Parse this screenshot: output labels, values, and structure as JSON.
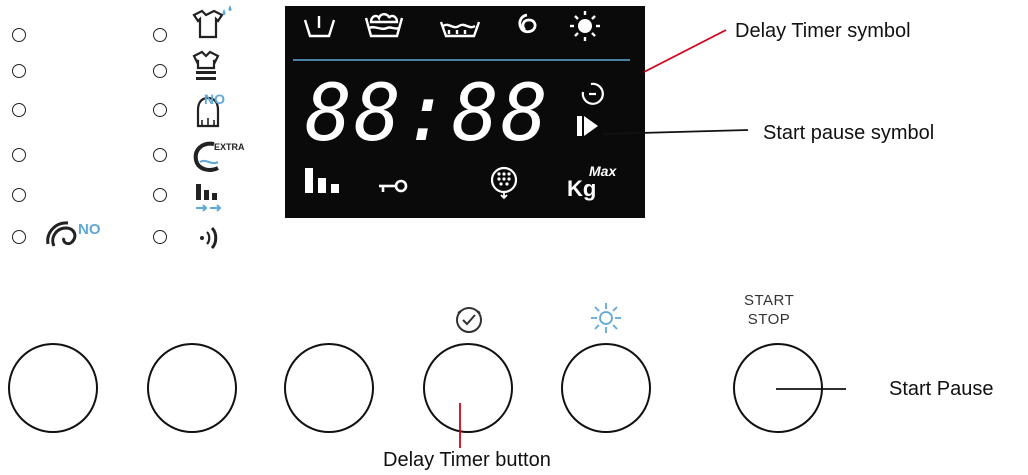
{
  "display": {
    "digits": "88:88",
    "top_icons": [
      "prewash-tub-icon",
      "bubbles-tub-icon",
      "wash-tub-icon",
      "spin-swirl-icon",
      "light-sun-icon"
    ],
    "bottom_icons": [
      "level-bars-icon",
      "key-lock-icon",
      "drain-icon",
      "kg-max-icon"
    ],
    "kg_label": "Kg",
    "max_label": "Max"
  },
  "indicators": {
    "left_column_icons": [
      "",
      "",
      "",
      "",
      "",
      "no-spin-icon"
    ],
    "left_no_label": "NO",
    "right_column_icons": [
      "shirt-drops-icon",
      "shirt-stack-icon",
      "iron-no-icon",
      "extra-rinse-icon",
      "bars-arrows-icon",
      "sound-waves-icon"
    ],
    "iron_no_label": "NO",
    "extra_label": "EXTRA"
  },
  "buttons": {
    "start_stop_line1": "START",
    "start_stop_line2": "STOP"
  },
  "callouts": {
    "delay_timer_symbol": "Delay Timer symbol",
    "start_pause_symbol": "Start pause symbol",
    "start_pause": "Start Pause",
    "delay_timer_button": "Delay Timer button"
  },
  "colors": {
    "display_bg": "#0a0a0a",
    "display_fg": "#ffffff",
    "accent_blue": "#5fa8d8",
    "callout_line": "#d0021b"
  }
}
